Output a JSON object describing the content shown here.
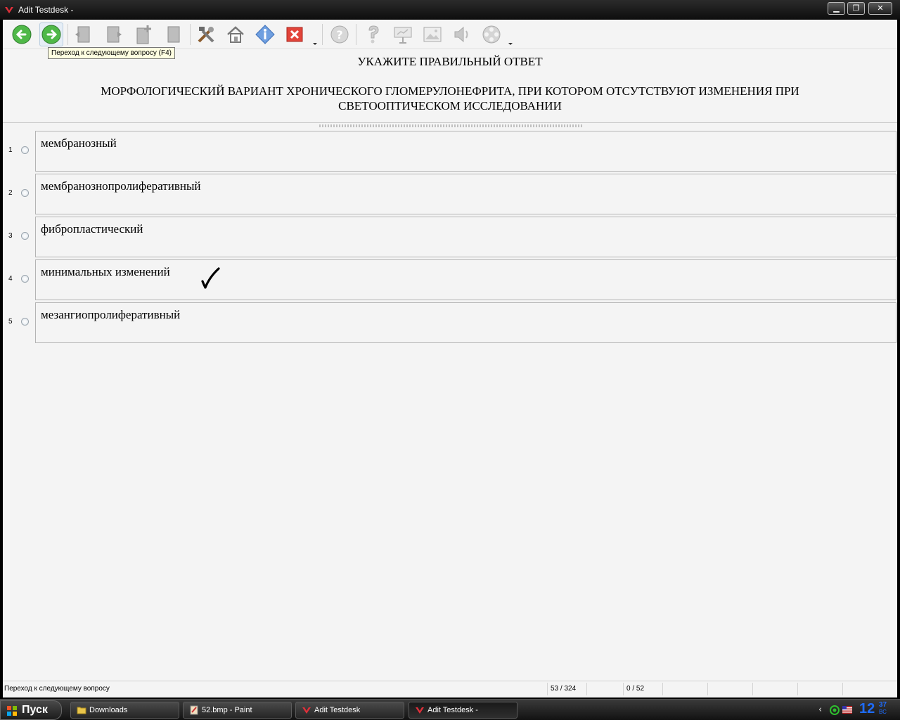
{
  "window": {
    "title": "Adit Testdesk -",
    "minimize": "▁",
    "maximize": "❐",
    "close": "✕"
  },
  "toolbar": {
    "items": [
      {
        "icon": "back-arrow-icon"
      },
      {
        "icon": "forward-arrow-icon"
      },
      {
        "icon": "page-left-icon"
      },
      {
        "icon": "page-right-icon"
      },
      {
        "icon": "page-add-icon"
      },
      {
        "icon": "page-icon"
      },
      {
        "icon": "tools-icon"
      },
      {
        "icon": "home-icon"
      },
      {
        "icon": "info-icon"
      },
      {
        "icon": "close-red-icon"
      },
      {
        "icon": "help-icon"
      },
      {
        "icon": "hint-icon"
      },
      {
        "icon": "presentation-icon"
      },
      {
        "icon": "image-icon"
      },
      {
        "icon": "sound-icon"
      },
      {
        "icon": "video-reel-icon"
      }
    ],
    "tooltip": "Переход к следующему вопросу (F4)"
  },
  "question": {
    "prompt": "УКАЖИТЕ ПРАВИЛЬНЫЙ ОТВЕТ",
    "text": "МОРФОЛОГИЧЕСКИЙ ВАРИАНТ ХРОНИЧЕСКОГО ГЛОМЕРУЛОНЕФРИТА, ПРИ КОТОРОМ ОТСУТСТВУЮТ ИЗМЕНЕНИЯ ПРИ СВЕТООПТИЧЕСКОМ ИССЛЕДОВАНИИ"
  },
  "answers": [
    {
      "num": "1",
      "text": "мембранозный"
    },
    {
      "num": "2",
      "text": "мембранознопролиферативный"
    },
    {
      "num": "3",
      "text": "фибропластический"
    },
    {
      "num": "4",
      "text": "минимальных изменений"
    },
    {
      "num": "5",
      "text": "мезангиопролиферативный"
    }
  ],
  "status": {
    "text": "Переход к следующему вопросу",
    "question_counter": "53 / 324",
    "empty1": "",
    "score": "0 / 52"
  },
  "taskbar": {
    "start": "Пуск",
    "tasks": [
      {
        "label": "Downloads",
        "icon": "folder-icon"
      },
      {
        "label": "52.bmp - Paint",
        "icon": "paint-icon"
      },
      {
        "label": "Adit Testdesk",
        "icon": "testdesk-icon"
      },
      {
        "label": "Adit Testdesk -",
        "icon": "testdesk-icon"
      }
    ],
    "clock_hour": "12",
    "clock_min": "37",
    "clock_day": "ВС"
  }
}
